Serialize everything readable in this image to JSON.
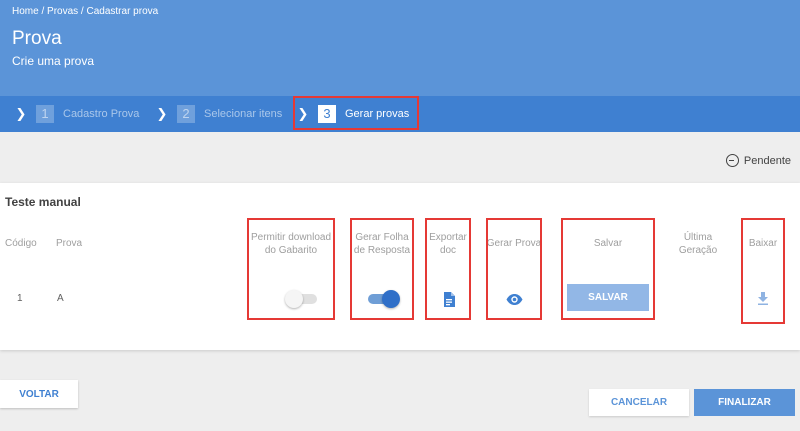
{
  "header": {
    "breadcrumb": [
      "Home",
      "Provas",
      "Cadastrar prova"
    ],
    "breadcrumb_sep": " / ",
    "title": "Prova",
    "subtitle": "Crie uma prova"
  },
  "stepper": {
    "steps": [
      {
        "number": "1",
        "label": "Cadastro Prova"
      },
      {
        "number": "2",
        "label": "Selecionar itens"
      },
      {
        "number": "3",
        "label": "Gerar provas"
      }
    ],
    "active_index": 2
  },
  "status": {
    "label": "Pendente",
    "icon": "minus-circle-icon"
  },
  "card": {
    "title": "Teste manual",
    "columns": {
      "codigo": "Código",
      "prova": "Prova",
      "permitir_l1": "Permitir download",
      "permitir_l2": "do Gabarito",
      "gerar_folha_l1": "Gerar Folha",
      "gerar_folha_l2": "de Resposta",
      "exportar_l1": "Exportar",
      "exportar_l2": "doc",
      "gerar_prova": "Gerar Prova",
      "salvar": "Salvar",
      "ultima_l1": "Última",
      "ultima_l2": "Geração",
      "baixar": "Baixar"
    },
    "rows": [
      {
        "codigo": "1",
        "prova": "A",
        "permitir_download": false,
        "gerar_folha": true,
        "exportar_icon": "document-icon",
        "gerar_prova_icon": "eye-icon",
        "salvar_label": "SALVAR",
        "ultima_geracao": "",
        "baixar_icon": "download-icon"
      }
    ]
  },
  "footer": {
    "voltar": "VOLTAR",
    "cancelar": "CANCELAR",
    "finalizar": "FINALIZAR"
  },
  "colors": {
    "header": "#5b94d8",
    "stepper": "#3f80d1",
    "highlight": "#e53935",
    "primary": "#2f6fc8"
  }
}
